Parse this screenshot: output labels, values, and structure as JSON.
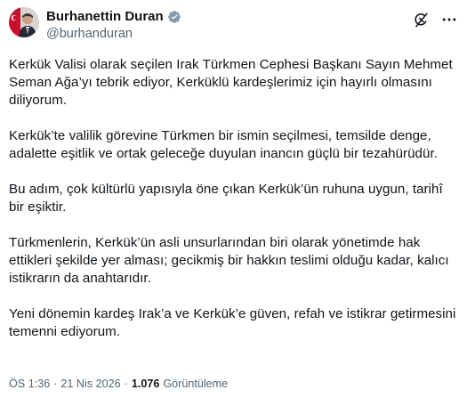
{
  "author": {
    "display_name": "Burhanettin Duran",
    "handle": "@burhanduran",
    "verified_color": "#829aab",
    "avatar_icon": "profile-photo-with-flag"
  },
  "actions": {
    "grok_icon": "grok-icon",
    "more_icon": "more-icon"
  },
  "tweet": {
    "paragraphs": [
      "Kerkük Valisi olarak seçilen Irak Türkmen Cephesi Başkanı Sayın Mehmet Seman Ağa’yı tebrik ediyor, Kerküklü kardeşlerimiz için hayırlı olmasını diliyorum.",
      "Kerkük’te valilik görevine Türkmen bir ismin seçilmesi, temsilde denge, adalette eşitlik ve ortak geleceğe duyulan inancın güçlü bir tezahürüdür.",
      "Bu adım, çok kültürlü yapısıyla öne çıkan Kerkük’ün ruhuna uygun, tarihî bir eşiktir.",
      "Türkmenlerin, Kerkük’ün asli unsurlarından biri olarak yönetimde hak ettikleri şekilde yer alması; gecikmiş bir hakkın teslimi olduğu kadar, kalıcı istikrarın da anahtarıdır.",
      "Yeni dönemin kardeş Irak’a ve Kerkük’e güven, refah ve istikrar getirmesini temenni ediyorum."
    ]
  },
  "meta": {
    "time": "ÖS 1:36",
    "separator": "·",
    "date": "21 Nis 2026",
    "views_count": "1.076",
    "views_label": "Görüntüleme"
  }
}
